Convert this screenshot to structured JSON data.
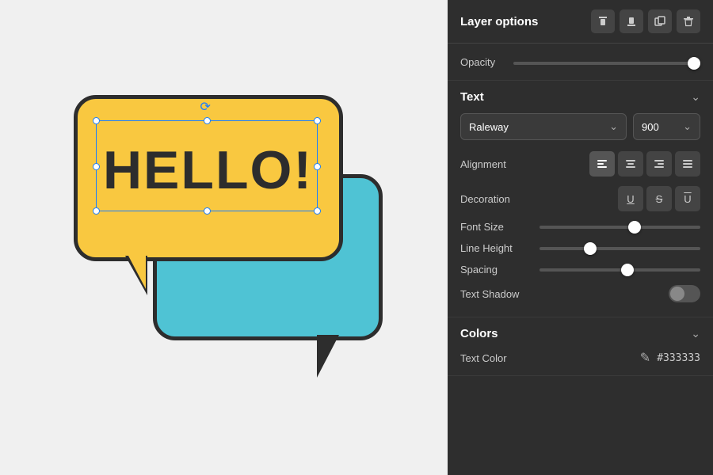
{
  "canvas": {
    "background": "#f0f0f0"
  },
  "illustration": {
    "hello_text": "HELLO!"
  },
  "panel": {
    "layer_options": {
      "title": "Layer options",
      "icons": [
        "align-top-icon",
        "align-bottom-icon",
        "copy-icon",
        "delete-icon"
      ]
    },
    "opacity": {
      "label": "Opacity",
      "value": 100,
      "percent": 100
    },
    "text_section": {
      "title": "Text",
      "collapsed": false,
      "font_name": "Raleway",
      "font_weight": "900",
      "alignment": {
        "label": "Alignment",
        "options": [
          "align-left",
          "align-center",
          "align-right",
          "align-justify"
        ]
      },
      "decoration": {
        "label": "Decoration",
        "options": [
          "underline",
          "strikethrough",
          "overline"
        ]
      },
      "font_size": {
        "label": "Font Size",
        "value": 60,
        "percent": 60
      },
      "line_height": {
        "label": "Line Height",
        "value": 30,
        "percent": 30
      },
      "spacing": {
        "label": "Spacing",
        "value": 55,
        "percent": 55
      },
      "text_shadow": {
        "label": "Text Shadow",
        "enabled": false
      }
    },
    "colors_section": {
      "title": "Colors",
      "collapsed": false,
      "text_color": {
        "label": "Text Color",
        "value": "#333333"
      }
    }
  }
}
